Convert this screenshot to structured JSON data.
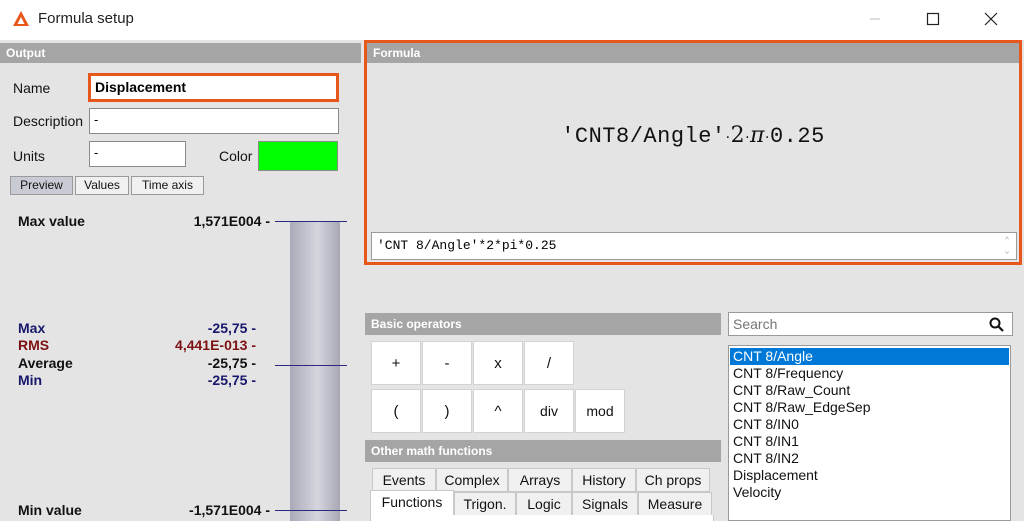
{
  "window": {
    "title": "Formula setup",
    "accent_color": "#e7561b"
  },
  "output": {
    "header": "Output",
    "name_label": "Name",
    "name_value": "Displacement",
    "description_label": "Description",
    "description_value": "-",
    "units_label": "Units",
    "units_value": "-",
    "color_label": "Color",
    "color_value": "#00ff00",
    "tabs": [
      {
        "label": "Preview",
        "active": true
      },
      {
        "label": "Values",
        "active": false
      },
      {
        "label": "Time axis",
        "active": false
      }
    ],
    "preview": {
      "max_value_label": "Max value",
      "max_value": "1,571E004 -",
      "stats": [
        {
          "label": "Max",
          "value": "-25,75 -"
        },
        {
          "label": "RMS",
          "value": "4,441E-013 -"
        },
        {
          "label": "Average",
          "value": "-25,75 -"
        },
        {
          "label": "Min",
          "value": "-25,75 -"
        }
      ],
      "min_value_label": "Min value",
      "min_value": "-1,571E004 -"
    }
  },
  "formula": {
    "header": "Formula",
    "display_channel": "'CNT8/Angle'",
    "display_dot1": "·",
    "display_two": "2",
    "display_dot2": "·",
    "display_pi": "π",
    "display_dot3": "·",
    "display_factor": "0.25",
    "expression": "'CNT 8/Angle'*2*pi*0.25"
  },
  "basic_operators": {
    "header": "Basic operators",
    "buttons": [
      "+",
      "-",
      "x",
      "/",
      "(",
      ")",
      "^",
      "div",
      "mod"
    ]
  },
  "math_functions": {
    "header": "Other math functions",
    "tabs_row1": [
      "Events",
      "Complex",
      "Arrays",
      "History",
      "Ch props"
    ],
    "tabs_row2": [
      "Functions",
      "Trigon.",
      "Logic",
      "Signals",
      "Measure"
    ],
    "active_tab": "Functions"
  },
  "search": {
    "placeholder": "Search"
  },
  "signals": {
    "items": [
      "CNT 8/Angle",
      "CNT 8/Frequency",
      "CNT 8/Raw_Count",
      "CNT 8/Raw_EdgeSep",
      "CNT 8/IN0",
      "CNT 8/IN1",
      "CNT 8/IN2",
      "Displacement",
      "Velocity"
    ],
    "selected": "CNT 8/Angle"
  }
}
